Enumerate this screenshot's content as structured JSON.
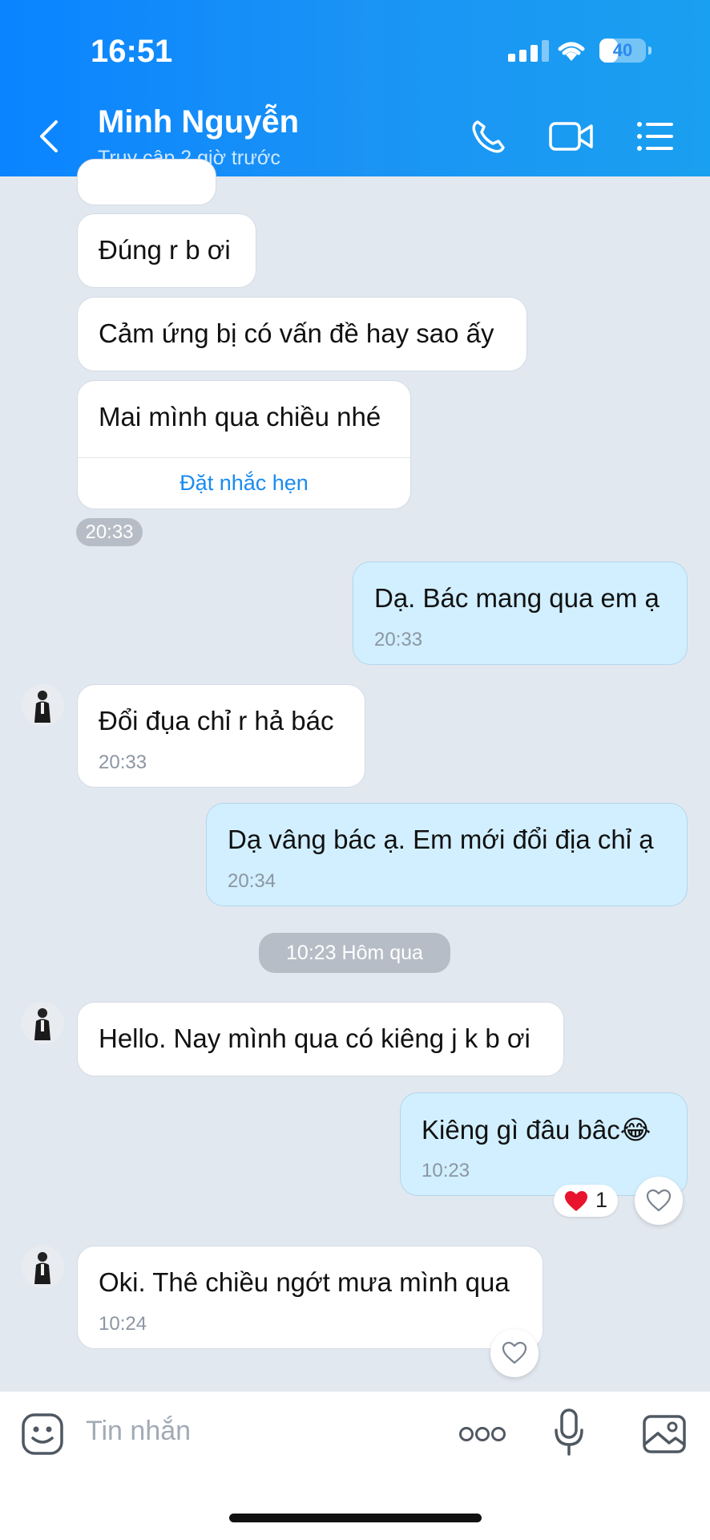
{
  "status_bar": {
    "time": "16:51",
    "battery": "40",
    "battery_level": 0.4
  },
  "header": {
    "contact_name": "Minh Nguyễn",
    "status": "Truy cập 2 giờ trước"
  },
  "messages": [
    {
      "text": "Đúng r b ơi"
    },
    {
      "text": "Cảm ứng bị có vấn đề hay sao ấy"
    },
    {
      "text": "Mai mình qua chiều nhé",
      "action": "Đặt nhắc hẹn"
    },
    {
      "time": "20:33"
    },
    {
      "text": "Dạ. Bác mang qua em ạ",
      "time": "20:33"
    },
    {
      "text": "Đổi đụa chỉ r hả bác",
      "time": "20:33"
    },
    {
      "text": "Dạ vâng bác ạ. Em mới đổi địa chỉ ạ",
      "time": "20:34"
    },
    {
      "text": "10:23 Hôm qua"
    },
    {
      "text": "Hello. Nay mình qua có kiêng j k b ơi"
    },
    {
      "text": "Kiêng gì đâu bâc",
      "emoji": "😂",
      "time": "10:23",
      "reaction_count": "1"
    },
    {
      "text": "Oki. Thê chiều ngớt mưa mình qua",
      "time": "10:24"
    }
  ],
  "input": {
    "placeholder": "Tin nhắn"
  },
  "colors": {
    "header": "#0a84ff",
    "outgoing": "#d1efff",
    "incoming": "#ffffff",
    "link": "#1a8cf0",
    "background": "#e2e8f0"
  },
  "icons": [
    "back-icon",
    "phone-icon",
    "video-call-icon",
    "menu-icon",
    "heart-icon",
    "sticker-icon",
    "more-icon",
    "microphone-icon",
    "image-icon"
  ]
}
